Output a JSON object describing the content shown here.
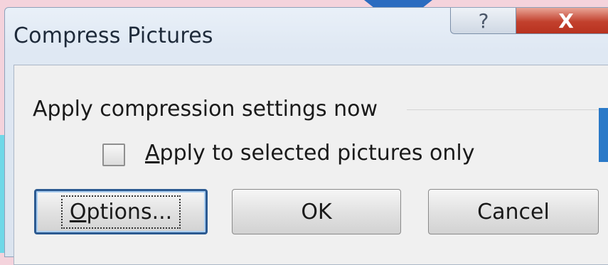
{
  "window": {
    "title": "Compress Pictures",
    "help_glyph": "?",
    "close_glyph": "X"
  },
  "compression": {
    "group_label": "Apply compression settings now",
    "checkbox_label_mnemonic": "A",
    "checkbox_label_rest": "pply to selected pictures only",
    "checkbox_checked": false
  },
  "buttons": {
    "options_mnemonic": "O",
    "options_rest": "ptions...",
    "ok": "OK",
    "cancel": "Cancel"
  }
}
